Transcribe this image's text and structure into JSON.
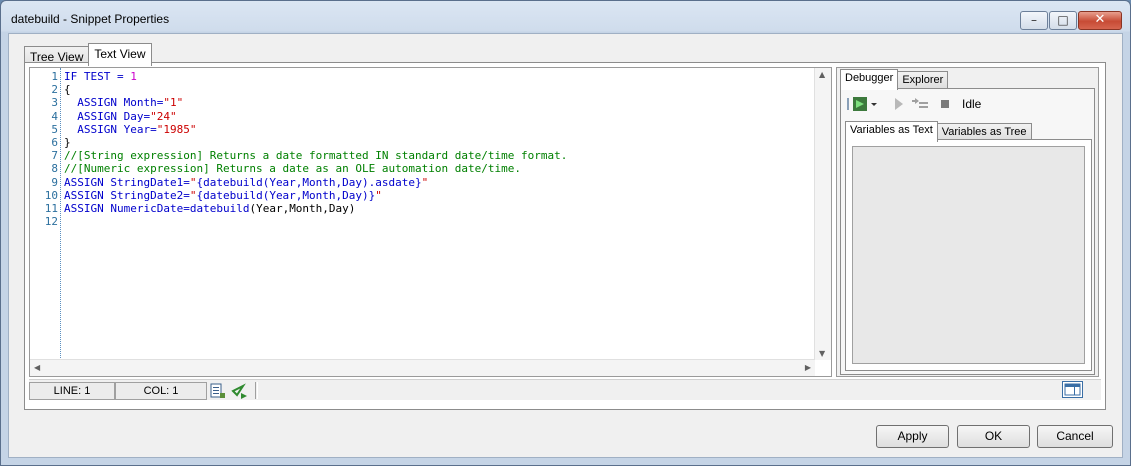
{
  "window": {
    "title": "datebuild - Snippet Properties",
    "minimize_glyph": "–",
    "maximize_glyph": "□",
    "close_glyph": "✕"
  },
  "main_tabs": [
    {
      "label": "Tree View"
    },
    {
      "label": "Text View",
      "active": true
    }
  ],
  "editor": {
    "line_numbers": [
      "1",
      "2",
      "3",
      "4",
      "5",
      "6",
      "7",
      "8",
      "9",
      "10",
      "11",
      "12"
    ],
    "lines": [
      [
        "IF TEST = ",
        "1"
      ],
      [
        "{"
      ],
      [
        "  ASSIGN Month=",
        "\"1\""
      ],
      [
        "  ASSIGN Day=",
        "\"24\""
      ],
      [
        "  ASSIGN Year=",
        "\"1985\""
      ],
      [
        "}"
      ],
      [
        "//[String expression] Returns a date formatted IN standard date/time format."
      ],
      [
        "//[Numeric expression] Returns a date as an OLE automation date/time."
      ],
      [
        "ASSIGN StringDate1=",
        "\"",
        "{datebuild(Year,Month,Day).asdate}",
        "\""
      ],
      [
        "ASSIGN StringDate2=",
        "\"",
        "{datebuild(Year,Month,Day)}",
        "\""
      ],
      [
        "ASSIGN NumericDate=",
        "datebuild",
        "(Year,Month,Day)"
      ],
      [
        ""
      ]
    ]
  },
  "status": {
    "line": "LINE: 1",
    "col": "COL: 1"
  },
  "right_panel": {
    "tabs": [
      {
        "label": "Debugger",
        "active": true
      },
      {
        "label": "Explorer"
      }
    ],
    "state": "Idle",
    "var_tabs": [
      {
        "label": "Variables as Text",
        "active": true
      },
      {
        "label": "Variables as Tree"
      }
    ]
  },
  "buttons": {
    "apply": "Apply",
    "ok": "OK",
    "cancel": "Cancel"
  }
}
